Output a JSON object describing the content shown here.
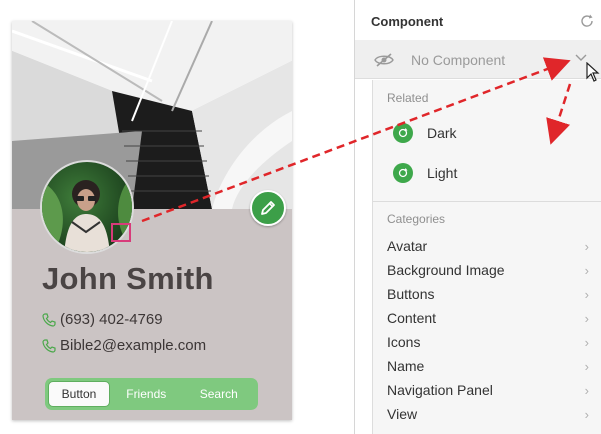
{
  "card": {
    "name": "John Smith",
    "phone": "(693) 402-4769",
    "email": "Bible2@example.com",
    "nav": [
      "Button",
      "Friends",
      "Search"
    ]
  },
  "panel": {
    "title": "Component",
    "combo_value": "No Component",
    "related_label": "Related",
    "related": [
      "Dark",
      "Light"
    ],
    "categories_label": "Categories",
    "categories": [
      "Avatar",
      "Background Image",
      "Buttons",
      "Content",
      "Icons",
      "Name",
      "Navigation Panel",
      "View"
    ]
  },
  "colors": {
    "accent_green": "#3ea84b",
    "arrow_red": "#e0262a",
    "highlight_pink": "#d83b7a"
  },
  "icons": [
    "pencil-icon",
    "phone-icon",
    "refresh-icon",
    "eye-off-icon",
    "chevron-down-icon",
    "swap-icon",
    "chevron-right-icon",
    "mouse-cursor-icon"
  ]
}
